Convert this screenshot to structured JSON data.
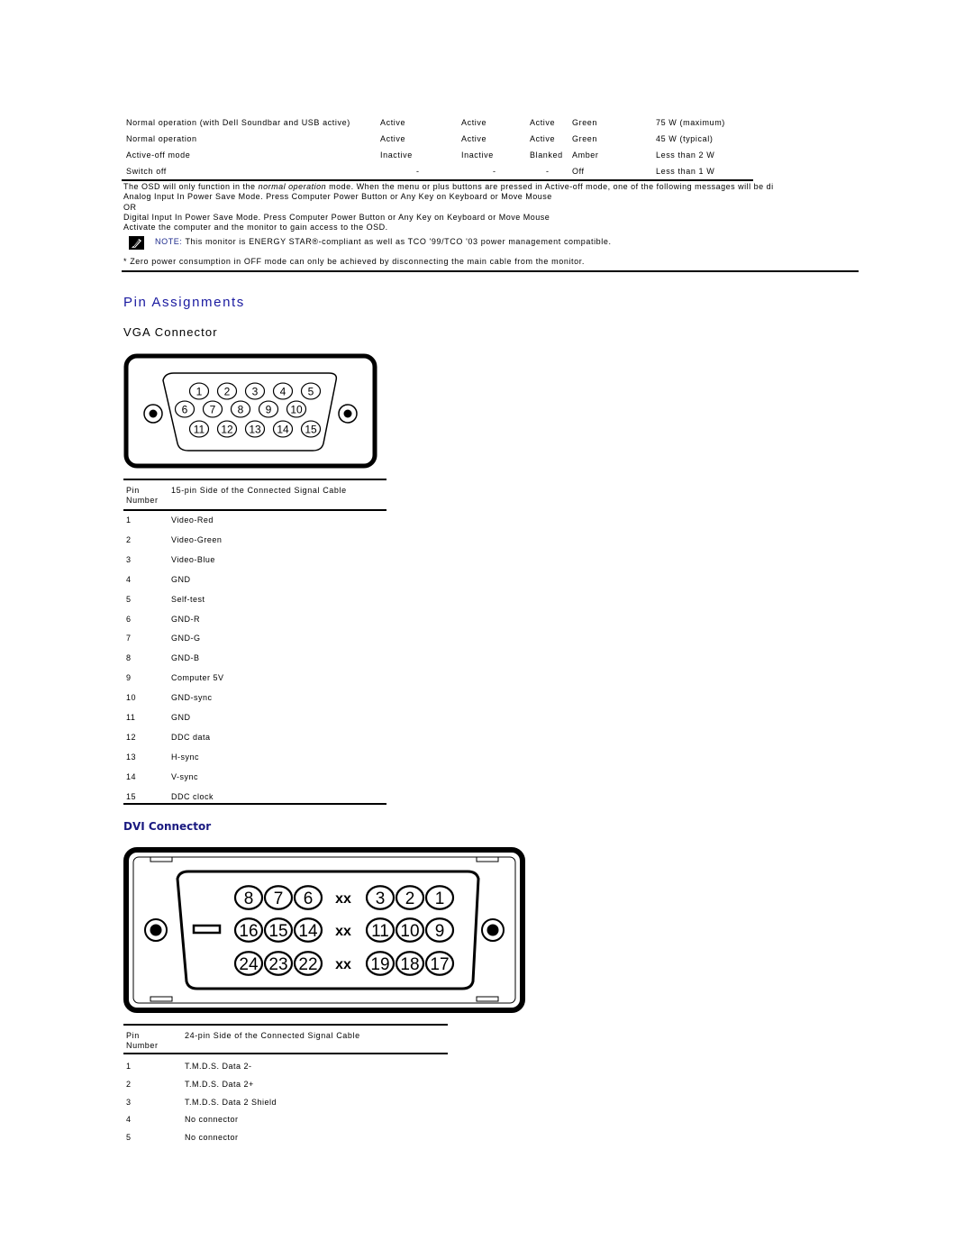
{
  "power_table": {
    "rows": [
      {
        "mode": "Normal operation (with Dell Soundbar and USB active)",
        "h_sync": "Active",
        "v_sync": "Active",
        "video": "Active",
        "power_indicator": "Green",
        "power_consumption": "75 W (maximum)"
      },
      {
        "mode": "Normal operation",
        "h_sync": "Active",
        "v_sync": "Active",
        "video": "Active",
        "power_indicator": "Green",
        "power_consumption": "45 W (typical)"
      },
      {
        "mode": "Active-off mode",
        "h_sync": "Inactive",
        "v_sync": "Inactive",
        "video": "Blanked",
        "power_indicator": "Amber",
        "power_consumption": "Less than 2 W"
      },
      {
        "mode": "Switch off",
        "h_sync": "-",
        "v_sync": "-",
        "video": "-",
        "power_indicator": "Off",
        "power_consumption": "Less than 1 W"
      }
    ]
  },
  "osd_info": {
    "line1_prefix": "The OSD will only function in the ",
    "line1_italic": "normal operation",
    "line1_suffix": " mode. When the menu or plus buttons are pressed in Active-off mode, one of the following messages will be di",
    "analog_message": "Analog Input In Power Save Mode. Press Computer Power Button or Any Key on Keyboard or Move Mouse",
    "or_text": "OR",
    "digital_message": "Digital Input In Power Save Mode. Press Computer Power Button or Any Key on Keyboard or Move Mouse",
    "activate_text": "Activate the computer and the monitor to gain access to the OSD."
  },
  "note": {
    "icon": "note-pencil-icon",
    "label": "NOTE:",
    "text": " This monitor is ENERGY STAR®-compliant as well as TCO '99/TCO '03 power management compatible."
  },
  "footnote": "* Zero power consumption in OFF mode can only be achieved by disconnecting the main cable from the monitor.",
  "pin_assignments": {
    "title": "Pin Assignments",
    "vga": {
      "title": "VGA Connector",
      "diagram_pins": {
        "row1": [
          "1",
          "2",
          "3",
          "4",
          "5"
        ],
        "row2": [
          "6",
          "7",
          "8",
          "9",
          "10"
        ],
        "row3": [
          "11",
          "12",
          "13",
          "14",
          "15"
        ]
      },
      "header_pin_line1": "Pin",
      "header_pin_line2": "Number",
      "header_signal": "15-pin Side of the Connected Signal Cable",
      "rows": [
        {
          "pin": "1",
          "signal": "Video-Red"
        },
        {
          "pin": "2",
          "signal": "Video-Green"
        },
        {
          "pin": "3",
          "signal": "Video-Blue"
        },
        {
          "pin": "4",
          "signal": "GND"
        },
        {
          "pin": "5",
          "signal": "Self-test"
        },
        {
          "pin": "6",
          "signal": "GND-R"
        },
        {
          "pin": "7",
          "signal": "GND-G"
        },
        {
          "pin": "8",
          "signal": "GND-B"
        },
        {
          "pin": "9",
          "signal": "Computer 5V"
        },
        {
          "pin": "10",
          "signal": "GND-sync"
        },
        {
          "pin": "11",
          "signal": "GND"
        },
        {
          "pin": "12",
          "signal": "DDC data"
        },
        {
          "pin": "13",
          "signal": "H-sync"
        },
        {
          "pin": "14",
          "signal": "V-sync"
        },
        {
          "pin": "15",
          "signal": "DDC clock"
        }
      ]
    },
    "dvi": {
      "title": "DVI Connector",
      "diagram_pins": {
        "row1_left": [
          "8",
          "7",
          "6"
        ],
        "row1_right": [
          "3",
          "2",
          "1"
        ],
        "row2_left": [
          "16",
          "15",
          "14"
        ],
        "row2_right": [
          "11",
          "10",
          "9"
        ],
        "row3_left": [
          "24",
          "23",
          "22"
        ],
        "row3_right": [
          "19",
          "18",
          "17"
        ],
        "gap_label": "xx"
      },
      "header_pin_line1": "Pin",
      "header_pin_line2": "Number",
      "header_signal": "24-pin Side of the Connected Signal Cable",
      "rows": [
        {
          "pin": "1",
          "signal": "T.M.D.S. Data 2-"
        },
        {
          "pin": "2",
          "signal": "T.M.D.S. Data 2+"
        },
        {
          "pin": "3",
          "signal": "T.M.D.S. Data 2 Shield"
        },
        {
          "pin": "4",
          "signal": "No connector"
        },
        {
          "pin": "5",
          "signal": "No connector"
        }
      ]
    }
  }
}
